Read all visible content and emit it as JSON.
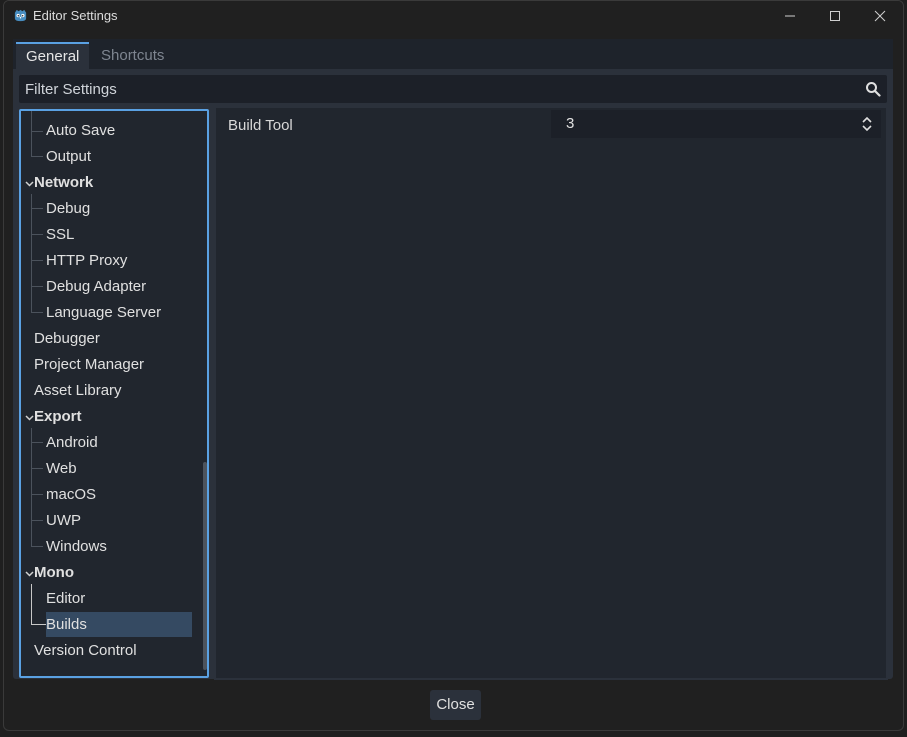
{
  "window": {
    "title": "Editor Settings"
  },
  "tabs": [
    {
      "label": "General"
    },
    {
      "label": "Shortcuts"
    }
  ],
  "filter": {
    "placeholder": "Filter Settings"
  },
  "tree": {
    "items": [
      {
        "label": "Auto Save"
      },
      {
        "label": "Output"
      },
      {
        "label": "Network"
      },
      {
        "label": "Debug"
      },
      {
        "label": "SSL"
      },
      {
        "label": "HTTP Proxy"
      },
      {
        "label": "Debug Adapter"
      },
      {
        "label": "Language Server"
      },
      {
        "label": "Debugger"
      },
      {
        "label": "Project Manager"
      },
      {
        "label": "Asset Library"
      },
      {
        "label": "Export"
      },
      {
        "label": "Android"
      },
      {
        "label": "Web"
      },
      {
        "label": "macOS"
      },
      {
        "label": "UWP"
      },
      {
        "label": "Windows"
      },
      {
        "label": "Mono"
      },
      {
        "label": "Editor"
      },
      {
        "label": "Builds"
      },
      {
        "label": "Version Control"
      }
    ],
    "selected": "Builds"
  },
  "properties": [
    {
      "label": "Build Tool",
      "value": "3"
    }
  ],
  "footer": {
    "close_label": "Close"
  },
  "colors": {
    "accent": "#5aa1e3",
    "selection": "#354a62",
    "panel": "#21262e",
    "background": "#2b313b"
  }
}
